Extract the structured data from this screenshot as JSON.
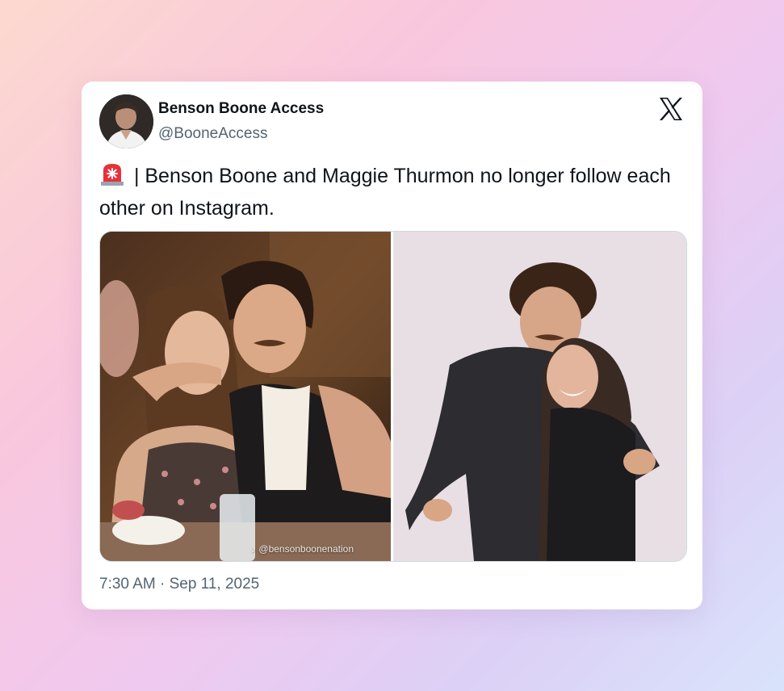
{
  "author": {
    "display_name": "Benson Boone Access",
    "handle": "@BooneAccess"
  },
  "tweet": {
    "emoji_icon": "police-car-light",
    "text": " | Benson Boone and Maggie Thurmon no longer follow each other on Instagram."
  },
  "media": {
    "watermark": "♪ @bensonboonenation"
  },
  "timestamp": "7:30 AM · Sep 11, 2025",
  "colors": {
    "text_primary": "#0f1419",
    "text_secondary": "#536471",
    "border": "#cfd9de"
  }
}
